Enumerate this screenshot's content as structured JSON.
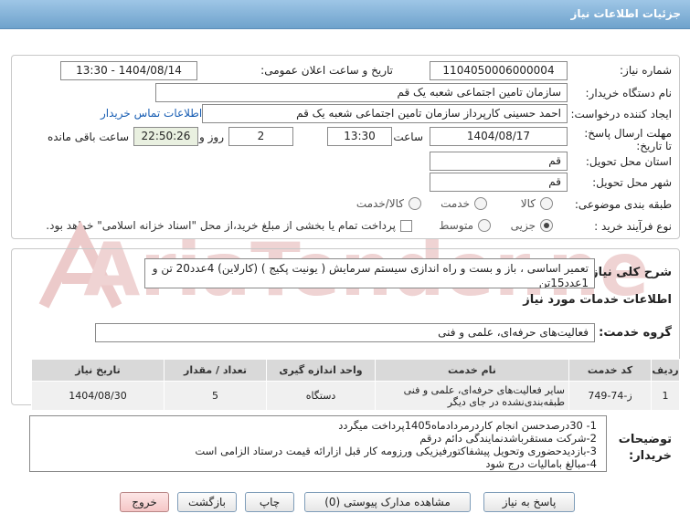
{
  "header": {
    "title": "جزئیات اطلاعات نیاز"
  },
  "form": {
    "need_number_label": "شماره نیاز:",
    "need_number": "1104050006000004",
    "announce_label": "تاریخ و ساعت اعلان عمومی:",
    "announce_value": "1404/08/14 - 13:30",
    "buyer_label": "نام دستگاه خریدار:",
    "buyer_value": "سازمان تامین اجتماعی شعبه یک قم",
    "creator_label": "ایجاد کننده درخواست:",
    "creator_value": "احمد حسینی کارپرداز سازمان تامین اجتماعی شعبه یک قم",
    "contact_link": "اطلاعات تماس خریدار",
    "deadline_label": "مهلت ارسال پاسخ: تا تاریخ:",
    "deadline_date": "1404/08/17",
    "time_label": "ساعت",
    "deadline_time": "13:30",
    "days_value": "2",
    "days_label": "روز و",
    "remaining_time": "22:50:26",
    "remaining_label": "ساعت باقی مانده",
    "province_label": "استان محل تحویل:",
    "province_value": "قم",
    "city_label": "شهر محل تحویل:",
    "city_value": "قم",
    "category_label": "طبقه بندی موضوعی:",
    "category_options": [
      "کالا",
      "خدمت",
      "کالا/خدمت"
    ],
    "process_label": "نوع فرآیند خرید :",
    "process_options": [
      "جزیی",
      "متوسط"
    ],
    "payment_note": "پرداخت تمام یا بخشی از مبلغ خرید،از محل \"اسناد خزانه اسلامی\" خواهد بود."
  },
  "summary": {
    "label": "شرح کلی نیاز:",
    "value": "تعمیر اساسی ، باز و بست و راه اندازی سیستم سرمایش ( یونیت پکیج ) (کارلاین)  4عدد20 تن و 1عدد15تن"
  },
  "services": {
    "section_title": "اطلاعات خدمات مورد نیاز",
    "group_label": "گروه خدمت:",
    "group_value": "فعالیت‌های حرفه‌ای، علمی و فنی",
    "columns": [
      "ردیف",
      "کد خدمت",
      "نام خدمت",
      "واحد اندازه گیری",
      "تعداد / مقدار",
      "تاریخ نیاز"
    ],
    "rows": [
      {
        "index": "1",
        "code": "ز-74-749",
        "name": "سایر فعالیت‌های حرفه‌ای، علمی و فنی طبقه‌بندی‌نشده در جای دیگر",
        "unit": "دستگاه",
        "qty": "5",
        "date": "1404/08/30"
      }
    ]
  },
  "notes": {
    "label": "توضیحات خریدار:",
    "lines": [
      "1- 30درصدحسن انجام کاردرمردادماه1405پرداخت میگردد",
      "2-شرکت مستقرباشدنمایندگی دائم درقم",
      "3-بازدیدحضوری وتحویل پیشفاکتورفیزیکی ورزومه کار قبل ازارائه قیمت درستاد الزامی است",
      "4-مبالغ بامالیات درج شود"
    ]
  },
  "buttons": {
    "reply": "پاسخ به نیاز",
    "docs": "مشاهده مدارک پیوستی (0)",
    "print": "چاپ",
    "back": "بازگشت",
    "exit": "خروج"
  },
  "watermark": {
    "text": "AriaTender.net"
  },
  "colors": {
    "header": "#7eaed6",
    "link": "#1a5fb4",
    "watermark": "#e08a8a"
  }
}
